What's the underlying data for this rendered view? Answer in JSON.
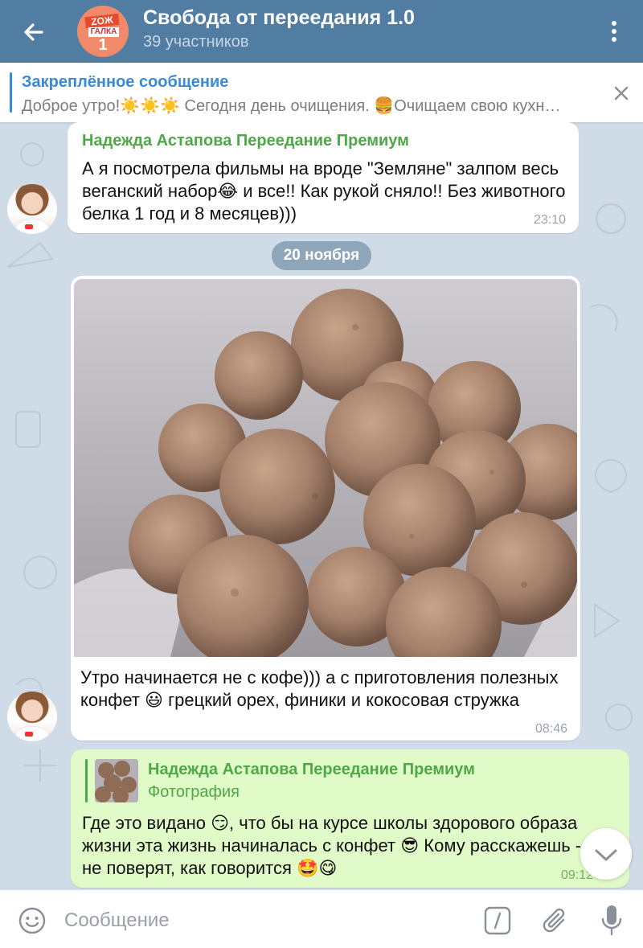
{
  "header": {
    "title": "Свобода от переедания 1.0",
    "subtitle": "39 участников",
    "avatar_lines": [
      "ZOЖ",
      "ГАЛКА",
      "1"
    ]
  },
  "pinned": {
    "title": "Закреплённое сообщение",
    "text": "Доброе утро!☀️☀️☀️   Сегодня день очищения.  🍔Очищаем свою кухн…"
  },
  "messages": [
    {
      "sender": "Надежда Астапова Переедание Премиум",
      "text": "А я посмотрела фильмы на вроде \"Земляне\" залпом весь веганский набор😂 и все!! Как рукой сняло!! Без животного белка 1 год и 8 месяцев)))",
      "time": "23:10"
    },
    {
      "caption": "Утро начинается не с кофе))) а с приготовления полезных конфет 😃 грецкий орех, финики и кокосовая стружка",
      "time": "08:46"
    },
    {
      "reply_to_sender": "Надежда Астапова Переедание Премиум",
      "reply_to_type": "Фотография",
      "text": "Где это видано 😏, что бы на курсе школы здорового образа жизни эта жизнь начиналась с конфет 😎 Кому расскажешь - не поверят, как говорится 🤩😋",
      "time": "09:12"
    }
  ],
  "date_separator": "20 ноября",
  "input": {
    "placeholder": "Сообщение",
    "value": ""
  },
  "colors": {
    "header_bg": "#517da2",
    "accent": "#3a8bd4",
    "sender_name": "#4fa847",
    "outgoing_bubble": "#e0fbc7",
    "chat_bg": "#cfdbe6"
  },
  "icons": [
    "back-arrow-icon",
    "more-vert-icon",
    "close-icon",
    "chevron-down-icon",
    "emoji-icon",
    "bot-command-icon",
    "paperclip-icon",
    "mic-icon"
  ]
}
